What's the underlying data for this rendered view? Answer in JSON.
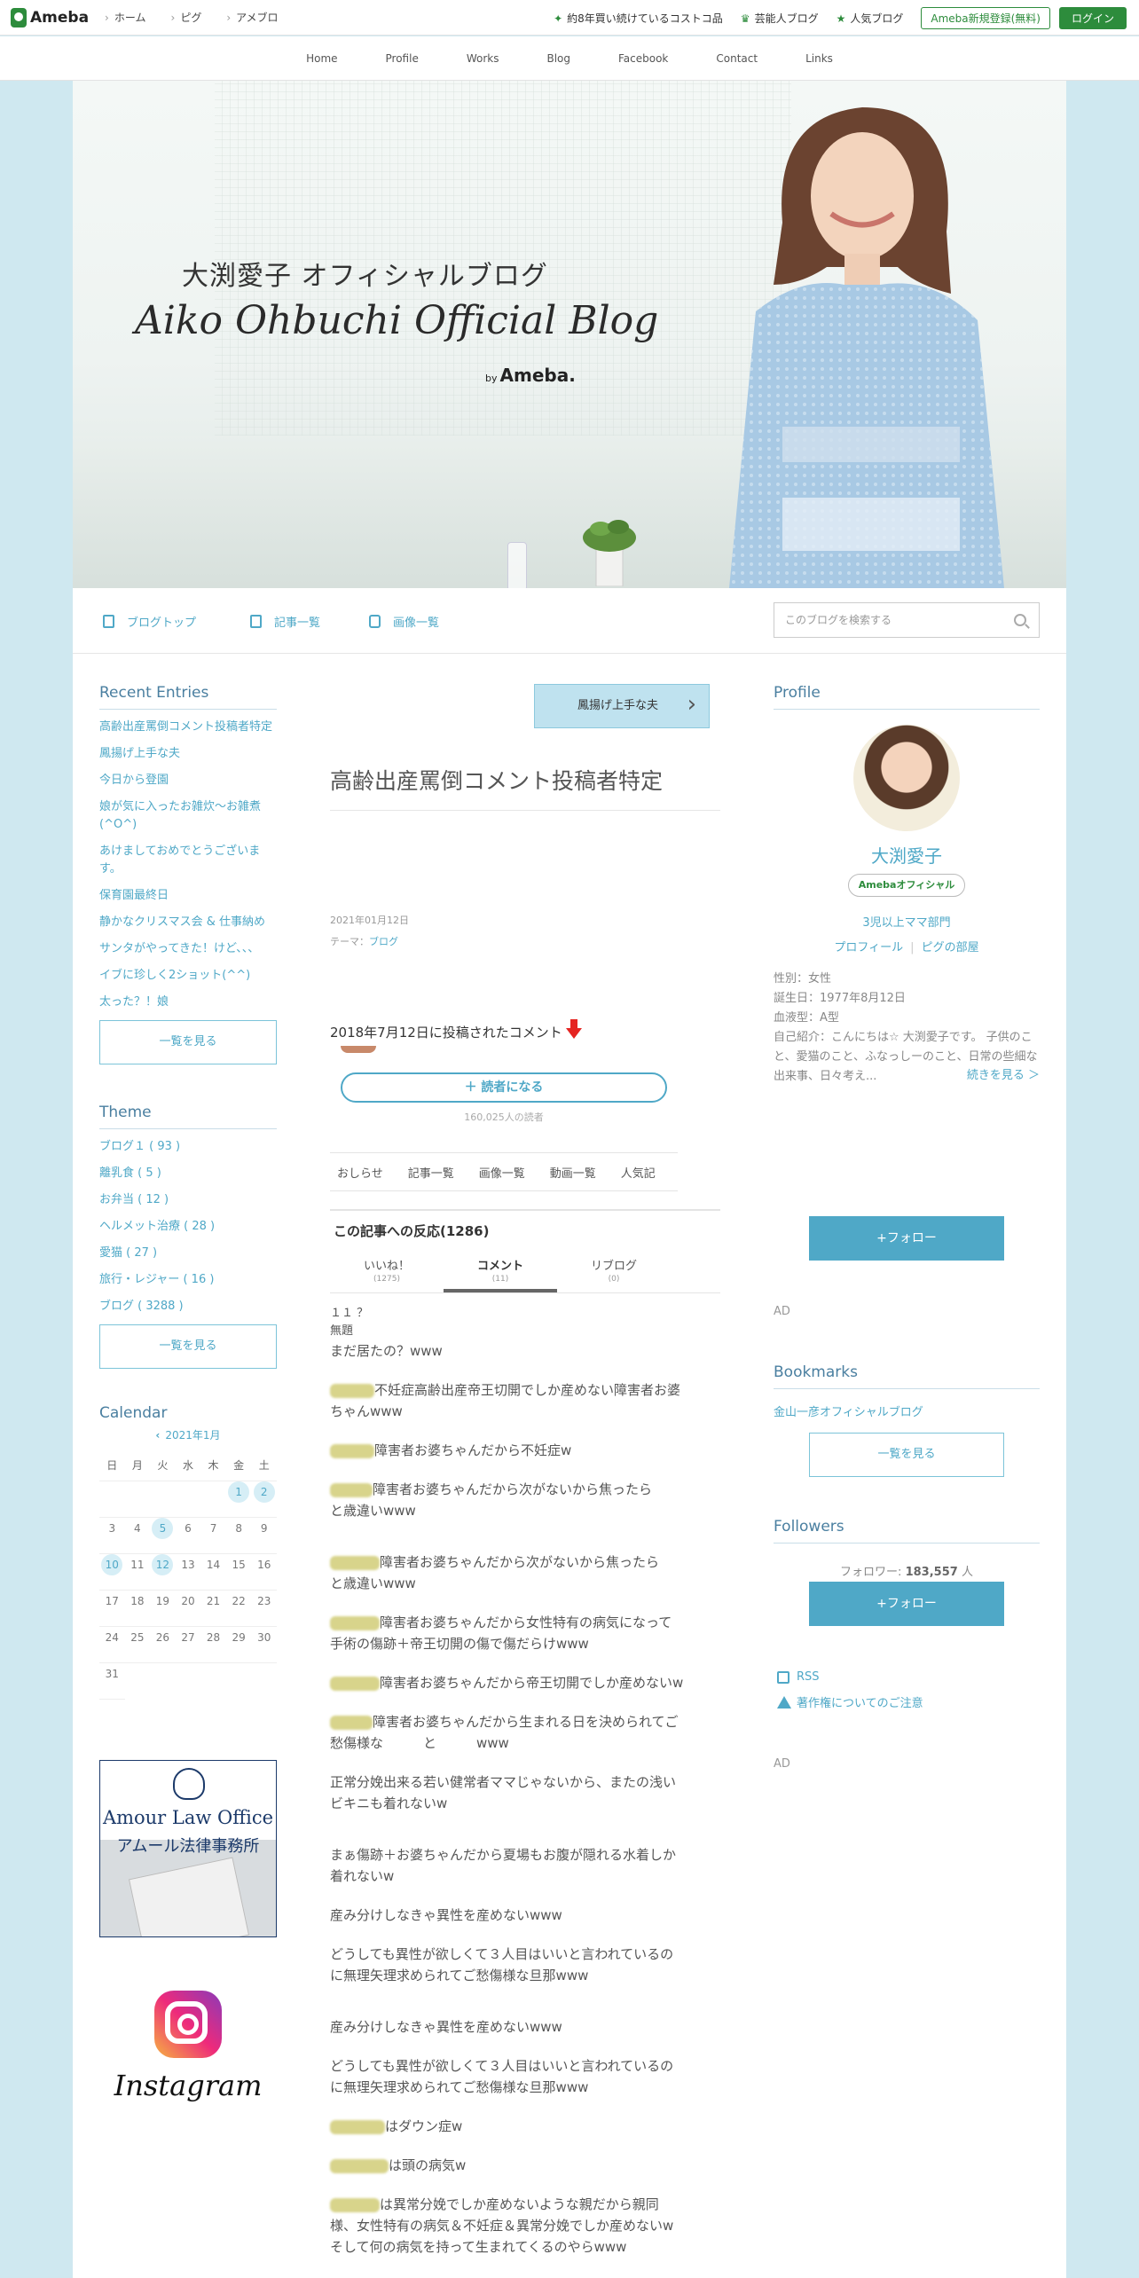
{
  "topbar": {
    "logo": "Ameba",
    "nav": [
      "ホーム",
      "ピグ",
      "アメブロ"
    ],
    "links": [
      "約8年買い続けているコストコ品",
      "芸能人ブログ",
      "人気ブログ"
    ],
    "register": "Ameba新規登録(無料)",
    "login": "ログイン"
  },
  "gnav": [
    "Home",
    "Profile",
    "Works",
    "Blog",
    "Facebook",
    "Contact",
    "Links"
  ],
  "hero": {
    "title_jp": "大渕愛子 オフィシャルブログ",
    "title_en": "Aiko Ohbuchi Official Blog",
    "by": "by",
    "brand": "Ameba."
  },
  "blogmenu": {
    "top": "ブログトップ",
    "list": "記事一覧",
    "images": "画像一覧",
    "search_placeholder": "このブログを検索する"
  },
  "left": {
    "recent_title": "Recent Entries",
    "recent": [
      "高齢出産罵倒コメント投稿者特定",
      "鳳揚げ上手な夫",
      "今日から登園",
      "娘が気に入ったお雑炊～お雑煮(^O^)",
      "あけましておめでとうございます。",
      "保育園最終日",
      "静かなクリスマス会 & 仕事納め",
      "サンタがやってきた！けど、、、",
      "イブに珍しく2ショット(^^)",
      "太った？！娘"
    ],
    "recent_more": "一覧を見る",
    "theme_title": "Theme",
    "themes": [
      "ブログ１ ( 93 )",
      "離乳食 ( 5 )",
      "お弁当 ( 12 )",
      "ヘルメット治療 ( 28 )",
      "愛猫 ( 27 )",
      "旅行・レジャー ( 16 )",
      "ブログ ( 3288 )"
    ],
    "theme_more": "一覧を見る",
    "calendar_title": "Calendar",
    "calendar_month": "2021年1月",
    "dow": [
      "日",
      "月",
      "火",
      "水",
      "木",
      "金",
      "土"
    ],
    "days": [
      "",
      "",
      "",
      "",
      "",
      "1",
      "2",
      "3",
      "4",
      "5",
      "6",
      "7",
      "8",
      "9",
      "10",
      "11",
      "12",
      "13",
      "14",
      "15",
      "16",
      "17",
      "18",
      "19",
      "20",
      "21",
      "22",
      "23",
      "24",
      "25",
      "26",
      "27",
      "28",
      "29",
      "30",
      "31"
    ],
    "highlighted_days": [
      "1",
      "2",
      "5",
      "10",
      "12"
    ],
    "banner_en": "Amour Law Office",
    "banner_jp": "アムール法律事務所",
    "insta": "Instagram"
  },
  "article": {
    "next": "鳳揚げ上手な夫",
    "title": "高齢出産罵倒コメント投稿者特定",
    "date": "2021年01月12日",
    "theme_label": "テーマ：",
    "theme": "ブログ",
    "first_line": "2018年7月12日に投稿されたコメント",
    "reader_btn": "＋ 読者になる",
    "reader_count": "160,025人の読者",
    "tabs": [
      "おしらせ",
      "記事一覧",
      "画像一覧",
      "動画一覧",
      "人気記"
    ],
    "reactions_title": "この記事への反応(1286)",
    "rtabs": [
      {
        "label": "いいね！",
        "count": "(1275)"
      },
      {
        "label": "コメント",
        "count": "(11)"
      },
      {
        "label": "リブログ",
        "count": "(0)"
      }
    ],
    "comment_no": "１１ ？",
    "comment_title": "無題",
    "comments": [
      "まだ居たの？www",
      "不妊症高齢出産帝王切開でしか産めない障害者お婆ちゃんwww",
      "障害者お婆ちゃんだから不妊症w",
      "障害者お婆ちゃんだから次がないから焦ったら　　　　　　　と歳違いwww",
      "障害者お婆ちゃんだから次がないから焦ったら　　　　　　　と歳違いwww",
      "障害者お婆ちゃんだから女性特有の病気になって手術の傷跡＋帝王切開の傷で傷だらけwww",
      "障害者お婆ちゃんだから帝王切開でしか産めないw",
      "障害者お婆ちゃんだから生まれる日を決められてご愁傷様な　　　と　　　www",
      "正常分娩出来る若い健常者ママじゃないから、またの浅いビキニも着れないw",
      "まぁ傷跡＋お婆ちゃんだから夏場もお腹が隠れる水着しか着れないw",
      "産み分けしなきゃ異性を産めないwww",
      "どうしても異性が欲しくて３人目はいいと言われているのに無理矢理求められてご愁傷様な旦那www",
      "産み分けしなきゃ異性を産めないwww",
      "どうしても異性が欲しくて３人目はいいと言われているのに無理矢理求められてご愁傷様な旦那www",
      "はダウン症w",
      "は頭の病気w",
      "は異常分娩でしか産めないような親だから親同様、女性特有の病気＆不妊症＆異常分娩でしか産めないwそして何の病気を持って生まれてくるのやらwww"
    ]
  },
  "right": {
    "profile_title": "Profile",
    "name": "大渕愛子",
    "badge": "Amebaオフィシャル",
    "category": "3児以上ママ部門",
    "link_profile": "プロフィール",
    "link_pig": "ピグの部屋",
    "info": [
      "性別：女性",
      "誕生日：1977年8月12日",
      "血液型：A型",
      "自己紹介：こんにちは☆ 大渕愛子です。 子供のこと、愛猫のこと、ふなっしーのこと、日常の些細な出来事、日々考え..."
    ],
    "more": "続きを見る ＞",
    "follow": "+フォロー",
    "ad": "AD",
    "bookmarks_title": "Bookmarks",
    "bookmark": "金山一彦オフィシャルブログ",
    "bookmark_more": "一覧を見る",
    "followers_title": "Followers",
    "followers_label": "フォロワー:",
    "followers_count": "183,557",
    "followers_unit": "人",
    "rss": "RSS",
    "copyright": "著作権についてのご注意"
  }
}
